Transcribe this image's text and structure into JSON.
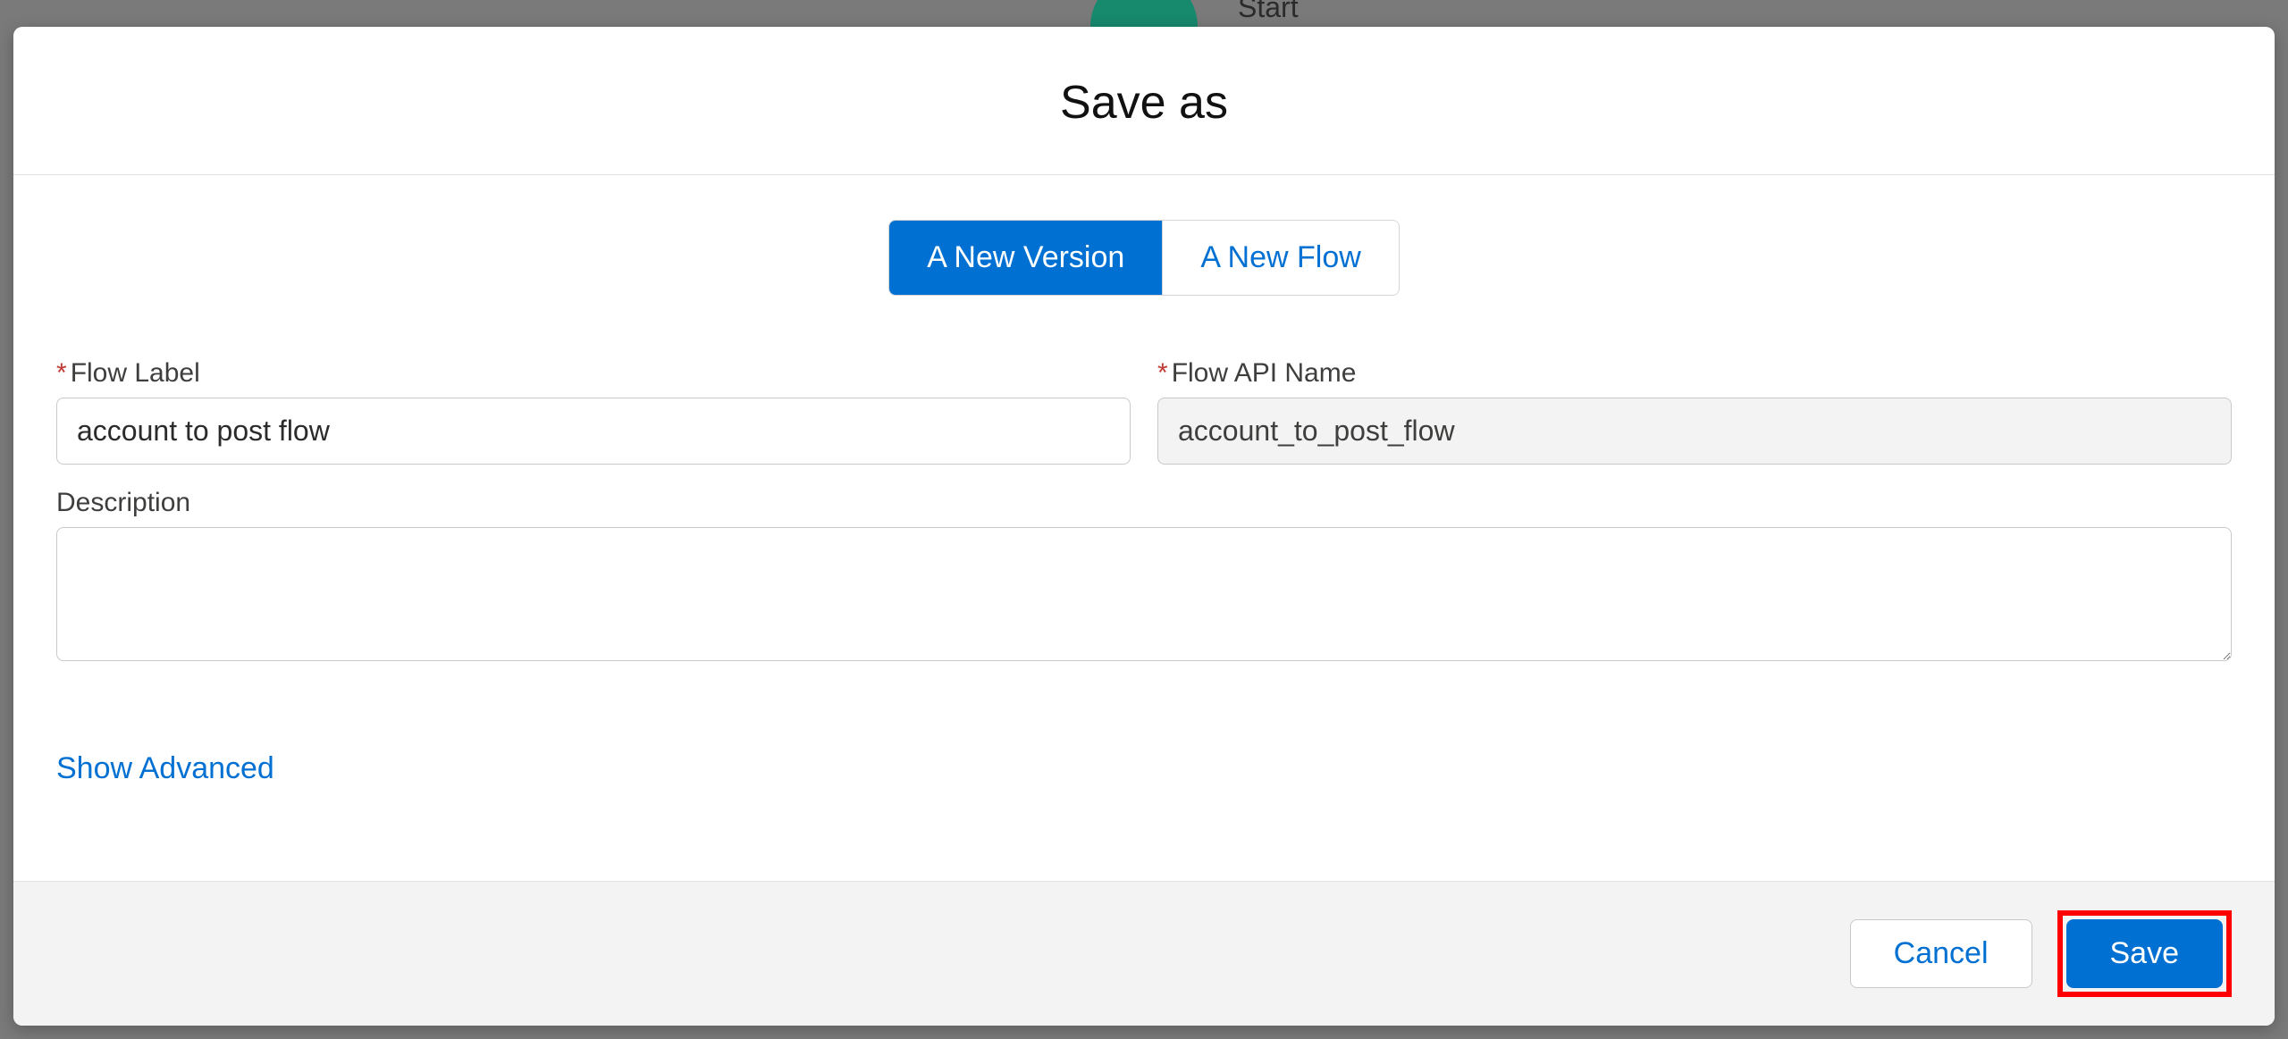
{
  "background": {
    "start_label": "Start"
  },
  "modal": {
    "title": "Save as",
    "segmented": {
      "new_version": "A New Version",
      "new_flow": "A New Flow"
    },
    "fields": {
      "flow_label": {
        "label": "Flow Label",
        "value": "account to post flow"
      },
      "flow_api_name": {
        "label": "Flow API Name",
        "value": "account_to_post_flow"
      },
      "description": {
        "label": "Description",
        "value": ""
      }
    },
    "show_advanced": "Show Advanced",
    "footer": {
      "cancel": "Cancel",
      "save": "Save"
    }
  }
}
